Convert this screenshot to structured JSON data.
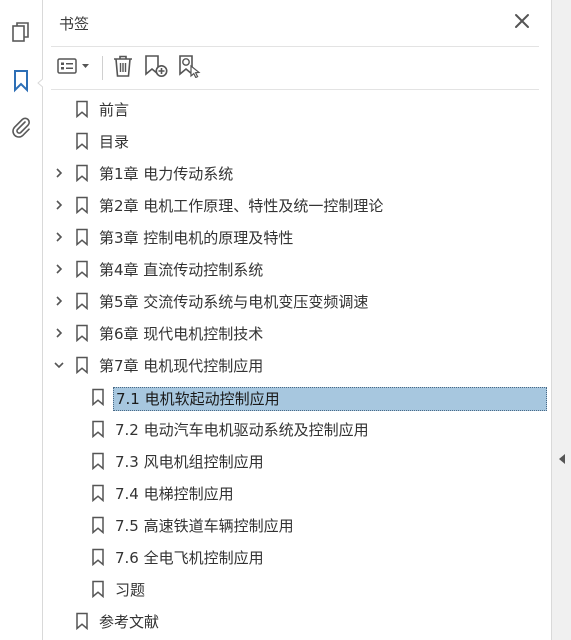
{
  "panel": {
    "title": "书签",
    "close_icon": "close-icon"
  },
  "rail": {
    "icons": [
      "page-thumbnails-icon",
      "bookmark-icon",
      "attachment-icon"
    ],
    "active": "bookmark-icon"
  },
  "toolbar": {
    "icons": [
      "options-menu-icon",
      "delete-bookmark-icon",
      "new-bookmark-icon",
      "find-current-bookmark-icon"
    ]
  },
  "colors": {
    "selected_bg": "#a7c7df",
    "accent": "#2d6fb6",
    "icon": "#5a5a5a"
  },
  "bookmarks": [
    {
      "label": "前言",
      "level": 0,
      "expander": "none"
    },
    {
      "label": "目录",
      "level": 0,
      "expander": "none"
    },
    {
      "label": "第1章 电力传动系统",
      "level": 0,
      "expander": "collapsed"
    },
    {
      "label": "第2章 电机工作原理、特性及统一控制理论",
      "level": 0,
      "expander": "collapsed"
    },
    {
      "label": "第3章 控制电机的原理及特性",
      "level": 0,
      "expander": "collapsed"
    },
    {
      "label": "第4章 直流传动控制系统",
      "level": 0,
      "expander": "collapsed"
    },
    {
      "label": "第5章 交流传动系统与电机变压变频调速",
      "level": 0,
      "expander": "collapsed"
    },
    {
      "label": "第6章 现代电机控制技术",
      "level": 0,
      "expander": "collapsed"
    },
    {
      "label": "第7章 电机现代控制应用",
      "level": 0,
      "expander": "expanded"
    },
    {
      "label": "7.1 电机软起动控制应用",
      "level": 1,
      "expander": "none",
      "selected": true
    },
    {
      "label": "7.2 电动汽车电机驱动系统及控制应用",
      "level": 1,
      "expander": "none"
    },
    {
      "label": "7.3 风电机组控制应用",
      "level": 1,
      "expander": "none"
    },
    {
      "label": "7.4 电梯控制应用",
      "level": 1,
      "expander": "none"
    },
    {
      "label": "7.5 高速铁道车辆控制应用",
      "level": 1,
      "expander": "none"
    },
    {
      "label": "7.6 全电飞机控制应用",
      "level": 1,
      "expander": "none"
    },
    {
      "label": "习题",
      "level": 1,
      "expander": "none"
    },
    {
      "label": "参考文献",
      "level": 0,
      "expander": "none"
    }
  ]
}
